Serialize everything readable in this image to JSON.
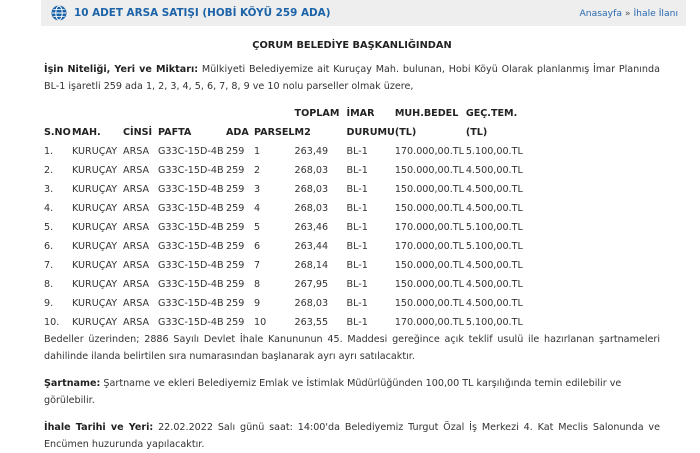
{
  "header": {
    "title": "10 ADET ARSA SATIŞI (HOBİ KÖYÜ 259 ADA)",
    "breadcrumb_home": "Anasayfa",
    "breadcrumb_sep": "»",
    "breadcrumb_current": "İhale İlanı"
  },
  "notice": {
    "heading": "ÇORUM BELEDİYE BAŞKANLIĞINDAN",
    "intro_label": "İşin Niteliği, Yeri ve Miktarı:",
    "intro_text": "Mülkiyeti Belediyemize ait Kuruçay Mah. bulunan, Hobi Köyü Olarak planlanmış İmar Planında BL-1 işaretli 259 ada 1, 2, 3, 4, 5, 6, 7, 8, 9 ve 10 nolu parseller olmak üzere,",
    "table": {
      "headers_top": [
        "",
        "",
        "",
        "",
        "",
        "",
        "TOPLAM",
        "İMAR",
        "MUH.BEDEL",
        "GEÇ.TEM."
      ],
      "headers_bottom": [
        "S.NO",
        "MAH.",
        "CİNSİ",
        "PAFTA",
        "ADA",
        "PARSEL",
        "M2",
        "DURUMU",
        "(TL)",
        "(TL)"
      ],
      "rows": [
        [
          "1.",
          "KURUÇAY",
          "ARSA",
          "G33C-15D-4B",
          "259",
          "1",
          "263,49",
          "BL-1",
          "170.000,00.TL",
          "5.100,00.TL"
        ],
        [
          "2.",
          "KURUÇAY",
          "ARSA",
          "G33C-15D-4B",
          "259",
          "2",
          "268,03",
          "BL-1",
          "150.000,00.TL",
          "4.500,00.TL"
        ],
        [
          "3.",
          "KURUÇAY",
          "ARSA",
          "G33C-15D-4B",
          "259",
          "3",
          "268,03",
          "BL-1",
          "150.000,00.TL",
          "4.500,00.TL"
        ],
        [
          "4.",
          "KURUÇAY",
          "ARSA",
          "G33C-15D-4B",
          "259",
          "4",
          "268,03",
          "BL-1",
          "150.000,00.TL",
          "4.500,00.TL"
        ],
        [
          "5.",
          "KURUÇAY",
          "ARSA",
          "G33C-15D-4B",
          "259",
          "5",
          "263,46",
          "BL-1",
          "170.000,00.TL",
          "5.100,00.TL"
        ],
        [
          "6.",
          "KURUÇAY",
          "ARSA",
          "G33C-15D-4B",
          "259",
          "6",
          "263,44",
          "BL-1",
          "170.000,00.TL",
          "5.100,00.TL"
        ],
        [
          "7.",
          "KURUÇAY",
          "ARSA",
          "G33C-15D-4B",
          "259",
          "7",
          "268,14",
          "BL-1",
          "150.000,00.TL",
          "4.500,00.TL"
        ],
        [
          "8.",
          "KURUÇAY",
          "ARSA",
          "G33C-15D-4B",
          "259",
          "8",
          "267,95",
          "BL-1",
          "150.000,00.TL",
          "4.500,00.TL"
        ],
        [
          "9.",
          "KURUÇAY",
          "ARSA",
          "G33C-15D-4B",
          "259",
          "9",
          "268,03",
          "BL-1",
          "150.000,00.TL",
          "4.500,00.TL"
        ],
        [
          "10.",
          "KURUÇAY",
          "ARSA",
          "G33C-15D-4B",
          "259",
          "10",
          "263,55",
          "BL-1",
          "170.000,00.TL",
          "5.100,00.TL"
        ]
      ]
    },
    "bedeller_text": "Bedeller üzerinden; 2886 Sayılı Devlet İhale Kanununun 45. Maddesi gereğince açık teklif usulü ile hazırlanan şartnameleri dahilinde ilanda belirtilen sıra numarasından başlanarak ayrı ayrı satılacaktır.",
    "sartname_label": "Şartname:",
    "sartname_text": "Şartname ve ekleri Belediyemiz Emlak ve İstimlak Müdürlüğünden 100,00 TL karşılığında temin edilebilir ve görülebilir.",
    "ihale_label": "İhale Tarihi ve Yeri:",
    "ihale_text": "22.02.2022 Salı günü saat: 14:00'da Belediyemiz Turgut Özal İş Merkezi 4. Kat Meclis Salonunda ve Encümen huzurunda yapılacaktır."
  },
  "icons": {
    "header_icon": "globe-icon"
  },
  "colors": {
    "title": "#1c63a8",
    "header_bg": "#eeeeee"
  }
}
